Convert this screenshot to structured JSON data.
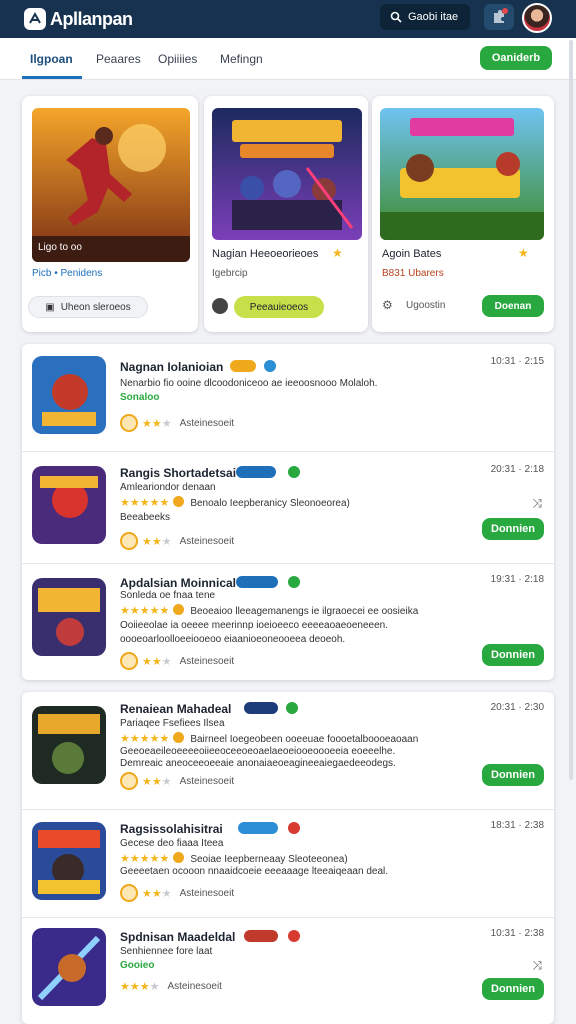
{
  "app": {
    "name": "Apllanpan"
  },
  "search": {
    "label": "Gaobi itae"
  },
  "nav": {
    "tabs": [
      "Ilgpoan",
      "Peaares",
      "Opiiiies",
      "Mefingn"
    ],
    "action": "Oaniderb"
  },
  "featured": [
    {
      "caption": "Ligo to oo",
      "title": "",
      "sub": "Picb • Penidens",
      "button": "Uheon sleroeos"
    },
    {
      "caption": "",
      "title": "Nagian Heeoeorieoes",
      "sub": "Igebrcip",
      "button": "Peeauieoeos"
    },
    {
      "caption": "",
      "title": "Agoin Bates",
      "sub": "B831 Ubarers",
      "button": "Doenan",
      "note": "Ugoostin"
    }
  ],
  "list_top": [
    {
      "title": "Nagnan Iolanioian",
      "date": "10:31 · 2:15",
      "line1": "Nenarbio fio ooine dlcoodoniceoo ae ieeoosnooo Molaloh.",
      "line2": "Sonaloo",
      "meta": "Asteinesoeit",
      "badge_color": "#f0a81c",
      "dot_color": "#2c8fd6"
    },
    {
      "title": "Rangis Shortadetsai",
      "date": "20:31 · 2:18",
      "line1": "Amleariondor denaan",
      "line2": "Benoalo Ieepberanicy Sleonoeorea)",
      "line3": "Beeabeeks",
      "meta": "Asteinesoeit",
      "button": "Donnien",
      "badge_color": "#1d6fb8",
      "dot_color": "#2aa840"
    },
    {
      "title": "Apdalsian Moinnical",
      "date": "19:31 · 2:18",
      "line1": "Sonleda oe fnaa tene",
      "line2": "Beoeaioo lleeagemanengs ie ilgraoecei ee oosieika",
      "line3": "Ooiieeolae ia oeeee meerinnp ioeioeeco eeeeaoaeoeneeen.",
      "line4": "oooeoarloolloeeiooeoo eiaanioeoneooeea deoeoh.",
      "meta": "Asteinesoeit",
      "button": "Donnien",
      "badge_color": "#1d6fb8",
      "dot_color": "#2aa840"
    }
  ],
  "list_bottom": [
    {
      "title": "Renaiean Mahadeal",
      "date": "20:31 · 2:30",
      "line1": "Pariaqee Fsefiees Ilsea",
      "line2": "Bairneel Ioegeobeen ooeeuae foooetalboooeaoaan",
      "line3": "Geeoeaeileoeeeeoiieeoceeoeoaelaeoeiooeoooeeia eoeeelhe.",
      "line4": "Demreaic aneoceeoeeaie anonaiaeoeagineeaiegaedeeodegs.",
      "meta": "Asteinesoeit",
      "button": "Donnien",
      "badge_color": "#1d3c7a",
      "dot_color": "#2aa840"
    },
    {
      "title": "Ragsissolahisitrai",
      "date": "18:31 · 2:38",
      "line1": "Gecese deo fiaaa Iteea",
      "line2": "Seoiae Ieepberneaay Sleoteeonea)",
      "line3": "Geeeetaen ocooon nnaaidcoeie eeeaaage lteeaiqeaan deal.",
      "meta": "Asteinesoeit",
      "badge_color": "#2c8fd6",
      "dot_color": "#d93a2f"
    },
    {
      "title": "Spdnisan Maadeldal",
      "date": "10:31 · 2:38",
      "line1": "Senhiennee fore laat",
      "line2": "Gooieo",
      "meta": "Asteinesoeit",
      "button": "Donnien",
      "badge_color": "#c0392b",
      "dot_color": "#d93a2f"
    }
  ]
}
